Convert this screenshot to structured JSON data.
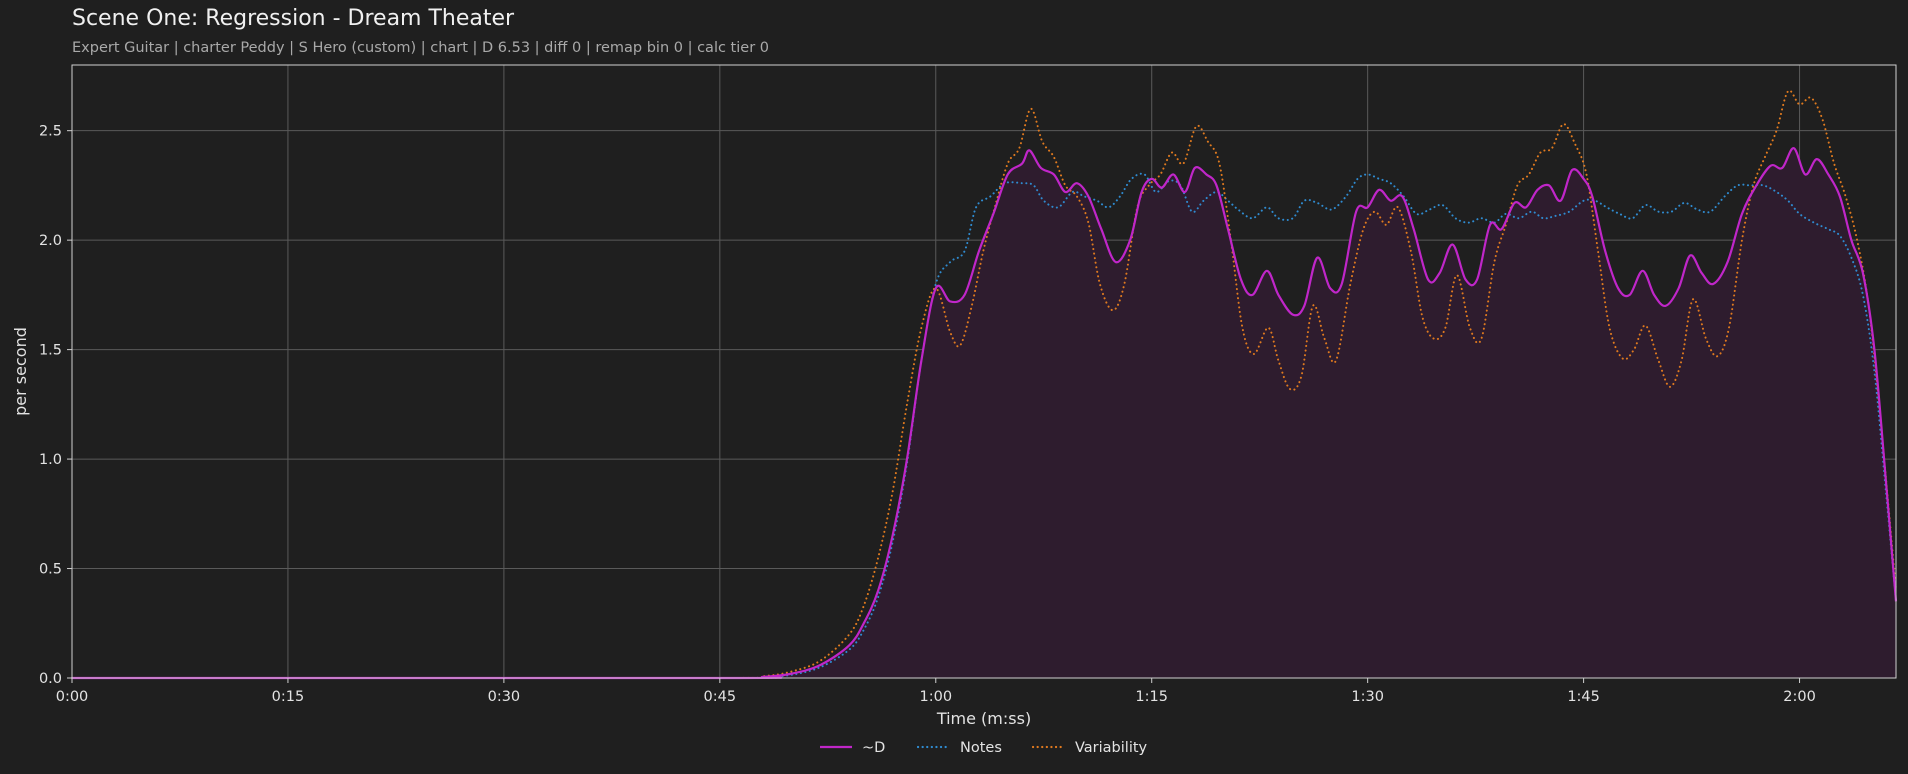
{
  "chart_data": {
    "type": "line",
    "title": "Scene One: Regression - Dream Theater",
    "subtitle": "Expert Guitar  |  charter Peddy  |  S Hero (custom)  |  chart  |  D 6.53  |  diff 0  |  remap bin 0  |  calc tier 0",
    "xlabel": "Time (m:ss)",
    "ylabel": "per second",
    "xlim": [
      0,
      126.7
    ],
    "ylim": [
      0,
      2.8
    ],
    "x_ticks": [
      {
        "value": 0,
        "label": "0:00"
      },
      {
        "value": 15,
        "label": "0:15"
      },
      {
        "value": 30,
        "label": "0:30"
      },
      {
        "value": 45,
        "label": "0:45"
      },
      {
        "value": 60,
        "label": "1:00"
      },
      {
        "value": 75,
        "label": "1:15"
      },
      {
        "value": 90,
        "label": "1:30"
      },
      {
        "value": 105,
        "label": "1:45"
      },
      {
        "value": 120,
        "label": "2:00"
      }
    ],
    "y_ticks": [
      {
        "value": 0,
        "label": "0.0"
      },
      {
        "value": 0.5,
        "label": "0.5"
      },
      {
        "value": 1.0,
        "label": "1.0"
      },
      {
        "value": 1.5,
        "label": "1.5"
      },
      {
        "value": 2.0,
        "label": "2.0"
      },
      {
        "value": 2.5,
        "label": "2.5"
      }
    ],
    "grid": true,
    "legend_position": "bottom-center",
    "colors": {
      "background": "#1f1f1f",
      "grid": "#5a5a5a",
      "fill": "#2e1c2e"
    },
    "series": [
      {
        "name": "~D",
        "color": "#c026c9",
        "style": "solid",
        "fill": true,
        "points": [
          [
            0,
            0
          ],
          [
            45,
            0
          ],
          [
            48,
            0.005
          ],
          [
            50,
            0.02
          ],
          [
            52,
            0.06
          ],
          [
            54,
            0.15
          ],
          [
            55,
            0.25
          ],
          [
            56,
            0.4
          ],
          [
            57,
            0.65
          ],
          [
            58,
            1.0
          ],
          [
            59,
            1.45
          ],
          [
            60,
            1.78
          ],
          [
            61,
            1.72
          ],
          [
            62,
            1.75
          ],
          [
            63,
            1.95
          ],
          [
            64,
            2.12
          ],
          [
            65,
            2.3
          ],
          [
            66,
            2.35
          ],
          [
            66.5,
            2.41
          ],
          [
            67.3,
            2.33
          ],
          [
            68.2,
            2.3
          ],
          [
            69,
            2.22
          ],
          [
            69.8,
            2.26
          ],
          [
            70.6,
            2.2
          ],
          [
            71.5,
            2.05
          ],
          [
            72.5,
            1.9
          ],
          [
            73.5,
            2.0
          ],
          [
            74.3,
            2.22
          ],
          [
            75,
            2.28
          ],
          [
            75.7,
            2.24
          ],
          [
            76.5,
            2.3
          ],
          [
            77.3,
            2.22
          ],
          [
            78,
            2.33
          ],
          [
            78.8,
            2.3
          ],
          [
            79.5,
            2.25
          ],
          [
            80.3,
            2.05
          ],
          [
            81.2,
            1.82
          ],
          [
            82,
            1.75
          ],
          [
            83,
            1.86
          ],
          [
            83.8,
            1.75
          ],
          [
            84.8,
            1.66
          ],
          [
            85.6,
            1.7
          ],
          [
            86.5,
            1.92
          ],
          [
            87.4,
            1.78
          ],
          [
            88.2,
            1.8
          ],
          [
            89.2,
            2.13
          ],
          [
            90,
            2.15
          ],
          [
            90.8,
            2.23
          ],
          [
            91.6,
            2.18
          ],
          [
            92.4,
            2.2
          ],
          [
            93.2,
            2.05
          ],
          [
            94.2,
            1.82
          ],
          [
            95,
            1.85
          ],
          [
            95.9,
            1.98
          ],
          [
            96.8,
            1.82
          ],
          [
            97.6,
            1.82
          ],
          [
            98.5,
            2.07
          ],
          [
            99.3,
            2.05
          ],
          [
            100.2,
            2.17
          ],
          [
            101,
            2.15
          ],
          [
            101.8,
            2.23
          ],
          [
            102.6,
            2.25
          ],
          [
            103.4,
            2.18
          ],
          [
            104.2,
            2.32
          ],
          [
            105,
            2.28
          ],
          [
            105.6,
            2.2
          ],
          [
            106.5,
            1.95
          ],
          [
            107.4,
            1.78
          ],
          [
            108.2,
            1.75
          ],
          [
            109.1,
            1.86
          ],
          [
            109.9,
            1.75
          ],
          [
            110.7,
            1.7
          ],
          [
            111.6,
            1.78
          ],
          [
            112.4,
            1.93
          ],
          [
            113.2,
            1.85
          ],
          [
            114,
            1.8
          ],
          [
            115,
            1.9
          ],
          [
            116,
            2.12
          ],
          [
            117,
            2.25
          ],
          [
            118,
            2.34
          ],
          [
            118.8,
            2.33
          ],
          [
            119.6,
            2.42
          ],
          [
            120.4,
            2.3
          ],
          [
            121.2,
            2.37
          ],
          [
            122,
            2.3
          ],
          [
            122.8,
            2.2
          ],
          [
            123.6,
            2.0
          ],
          [
            124.4,
            1.85
          ],
          [
            125.2,
            1.5
          ],
          [
            126,
            0.9
          ],
          [
            126.7,
            0.35
          ]
        ]
      },
      {
        "name": "Notes",
        "color": "#2f8bd0",
        "style": "dotted",
        "fill": false,
        "points": [
          [
            0,
            0
          ],
          [
            45,
            0
          ],
          [
            48,
            0.004
          ],
          [
            50,
            0.015
          ],
          [
            52,
            0.05
          ],
          [
            54,
            0.13
          ],
          [
            55,
            0.22
          ],
          [
            56,
            0.37
          ],
          [
            57,
            0.62
          ],
          [
            58,
            0.98
          ],
          [
            59,
            1.45
          ],
          [
            60,
            1.8
          ],
          [
            61,
            1.9
          ],
          [
            62,
            1.95
          ],
          [
            62.8,
            2.15
          ],
          [
            63.8,
            2.2
          ],
          [
            64.8,
            2.26
          ],
          [
            66,
            2.26
          ],
          [
            66.8,
            2.25
          ],
          [
            67.5,
            2.18
          ],
          [
            68.5,
            2.15
          ],
          [
            69.5,
            2.22
          ],
          [
            70.3,
            2.2
          ],
          [
            71.2,
            2.18
          ],
          [
            72,
            2.15
          ],
          [
            72.8,
            2.2
          ],
          [
            73.6,
            2.28
          ],
          [
            74.5,
            2.3
          ],
          [
            75.3,
            2.22
          ],
          [
            76.2,
            2.27
          ],
          [
            77,
            2.25
          ],
          [
            77.8,
            2.13
          ],
          [
            78.6,
            2.18
          ],
          [
            79.5,
            2.22
          ],
          [
            80.3,
            2.18
          ],
          [
            81,
            2.14
          ],
          [
            82,
            2.1
          ],
          [
            83,
            2.15
          ],
          [
            83.8,
            2.1
          ],
          [
            84.8,
            2.1
          ],
          [
            85.6,
            2.18
          ],
          [
            86.5,
            2.17
          ],
          [
            87.5,
            2.14
          ],
          [
            88.5,
            2.2
          ],
          [
            89.3,
            2.28
          ],
          [
            90,
            2.3
          ],
          [
            90.8,
            2.28
          ],
          [
            91.6,
            2.26
          ],
          [
            92.5,
            2.2
          ],
          [
            93.4,
            2.12
          ],
          [
            94.3,
            2.14
          ],
          [
            95.2,
            2.16
          ],
          [
            96.1,
            2.1
          ],
          [
            97,
            2.08
          ],
          [
            97.9,
            2.1
          ],
          [
            98.8,
            2.08
          ],
          [
            99.6,
            2.12
          ],
          [
            100.5,
            2.1
          ],
          [
            101.4,
            2.13
          ],
          [
            102.2,
            2.1
          ],
          [
            103,
            2.11
          ],
          [
            104,
            2.13
          ],
          [
            105,
            2.18
          ],
          [
            105.8,
            2.18
          ],
          [
            106.6,
            2.15
          ],
          [
            107.5,
            2.12
          ],
          [
            108.4,
            2.1
          ],
          [
            109.3,
            2.16
          ],
          [
            110.2,
            2.13
          ],
          [
            111.1,
            2.13
          ],
          [
            112,
            2.17
          ],
          [
            112.9,
            2.14
          ],
          [
            113.8,
            2.13
          ],
          [
            114.8,
            2.2
          ],
          [
            115.7,
            2.25
          ],
          [
            116.6,
            2.25
          ],
          [
            117.5,
            2.25
          ],
          [
            118.4,
            2.22
          ],
          [
            119.2,
            2.18
          ],
          [
            120,
            2.12
          ],
          [
            121,
            2.08
          ],
          [
            122,
            2.05
          ],
          [
            122.8,
            2.02
          ],
          [
            123.6,
            1.92
          ],
          [
            124.4,
            1.75
          ],
          [
            125.2,
            1.4
          ],
          [
            126,
            0.85
          ],
          [
            126.7,
            0.35
          ]
        ]
      },
      {
        "name": "Variability",
        "color": "#e07a1f",
        "style": "dotted",
        "fill": false,
        "points": [
          [
            0,
            0
          ],
          [
            45,
            0
          ],
          [
            48,
            0.008
          ],
          [
            50,
            0.03
          ],
          [
            52,
            0.08
          ],
          [
            54,
            0.2
          ],
          [
            55,
            0.33
          ],
          [
            56,
            0.55
          ],
          [
            57,
            0.85
          ],
          [
            58,
            1.25
          ],
          [
            59,
            1.6
          ],
          [
            60,
            1.78
          ],
          [
            61,
            1.58
          ],
          [
            61.7,
            1.52
          ],
          [
            62.5,
            1.7
          ],
          [
            63.3,
            1.95
          ],
          [
            64.1,
            2.15
          ],
          [
            65,
            2.35
          ],
          [
            65.8,
            2.42
          ],
          [
            66.6,
            2.6
          ],
          [
            67.4,
            2.45
          ],
          [
            68.2,
            2.38
          ],
          [
            69,
            2.25
          ],
          [
            69.8,
            2.2
          ],
          [
            70.6,
            2.08
          ],
          [
            71.4,
            1.8
          ],
          [
            72.3,
            1.68
          ],
          [
            73.1,
            1.8
          ],
          [
            74,
            2.15
          ],
          [
            74.8,
            2.25
          ],
          [
            75.6,
            2.3
          ],
          [
            76.4,
            2.4
          ],
          [
            77.2,
            2.35
          ],
          [
            78.1,
            2.52
          ],
          [
            78.9,
            2.45
          ],
          [
            79.7,
            2.35
          ],
          [
            80.5,
            2.0
          ],
          [
            81.3,
            1.6
          ],
          [
            82.1,
            1.48
          ],
          [
            83.1,
            1.6
          ],
          [
            83.8,
            1.45
          ],
          [
            84.6,
            1.32
          ],
          [
            85.4,
            1.38
          ],
          [
            86.2,
            1.7
          ],
          [
            87,
            1.55
          ],
          [
            87.8,
            1.45
          ],
          [
            88.8,
            1.8
          ],
          [
            89.7,
            2.05
          ],
          [
            90.5,
            2.13
          ],
          [
            91.3,
            2.07
          ],
          [
            92.1,
            2.15
          ],
          [
            93,
            1.95
          ],
          [
            93.8,
            1.65
          ],
          [
            94.6,
            1.55
          ],
          [
            95.4,
            1.6
          ],
          [
            96.2,
            1.84
          ],
          [
            97.1,
            1.6
          ],
          [
            97.9,
            1.55
          ],
          [
            98.8,
            1.9
          ],
          [
            99.6,
            2.07
          ],
          [
            100.4,
            2.25
          ],
          [
            101.2,
            2.3
          ],
          [
            102,
            2.4
          ],
          [
            102.8,
            2.42
          ],
          [
            103.6,
            2.53
          ],
          [
            104.4,
            2.44
          ],
          [
            105.2,
            2.3
          ],
          [
            106,
            1.95
          ],
          [
            106.8,
            1.6
          ],
          [
            107.7,
            1.46
          ],
          [
            108.5,
            1.5
          ],
          [
            109.3,
            1.61
          ],
          [
            110.2,
            1.45
          ],
          [
            111,
            1.33
          ],
          [
            111.8,
            1.45
          ],
          [
            112.6,
            1.73
          ],
          [
            113.5,
            1.55
          ],
          [
            114.3,
            1.47
          ],
          [
            115.1,
            1.6
          ],
          [
            116,
            2.0
          ],
          [
            116.8,
            2.25
          ],
          [
            117.6,
            2.38
          ],
          [
            118.4,
            2.5
          ],
          [
            119.2,
            2.68
          ],
          [
            120,
            2.62
          ],
          [
            120.8,
            2.65
          ],
          [
            121.6,
            2.55
          ],
          [
            122.4,
            2.35
          ],
          [
            123.2,
            2.2
          ],
          [
            124,
            2.0
          ],
          [
            124.8,
            1.7
          ],
          [
            125.6,
            1.2
          ],
          [
            126.7,
            0.4
          ]
        ]
      }
    ]
  }
}
